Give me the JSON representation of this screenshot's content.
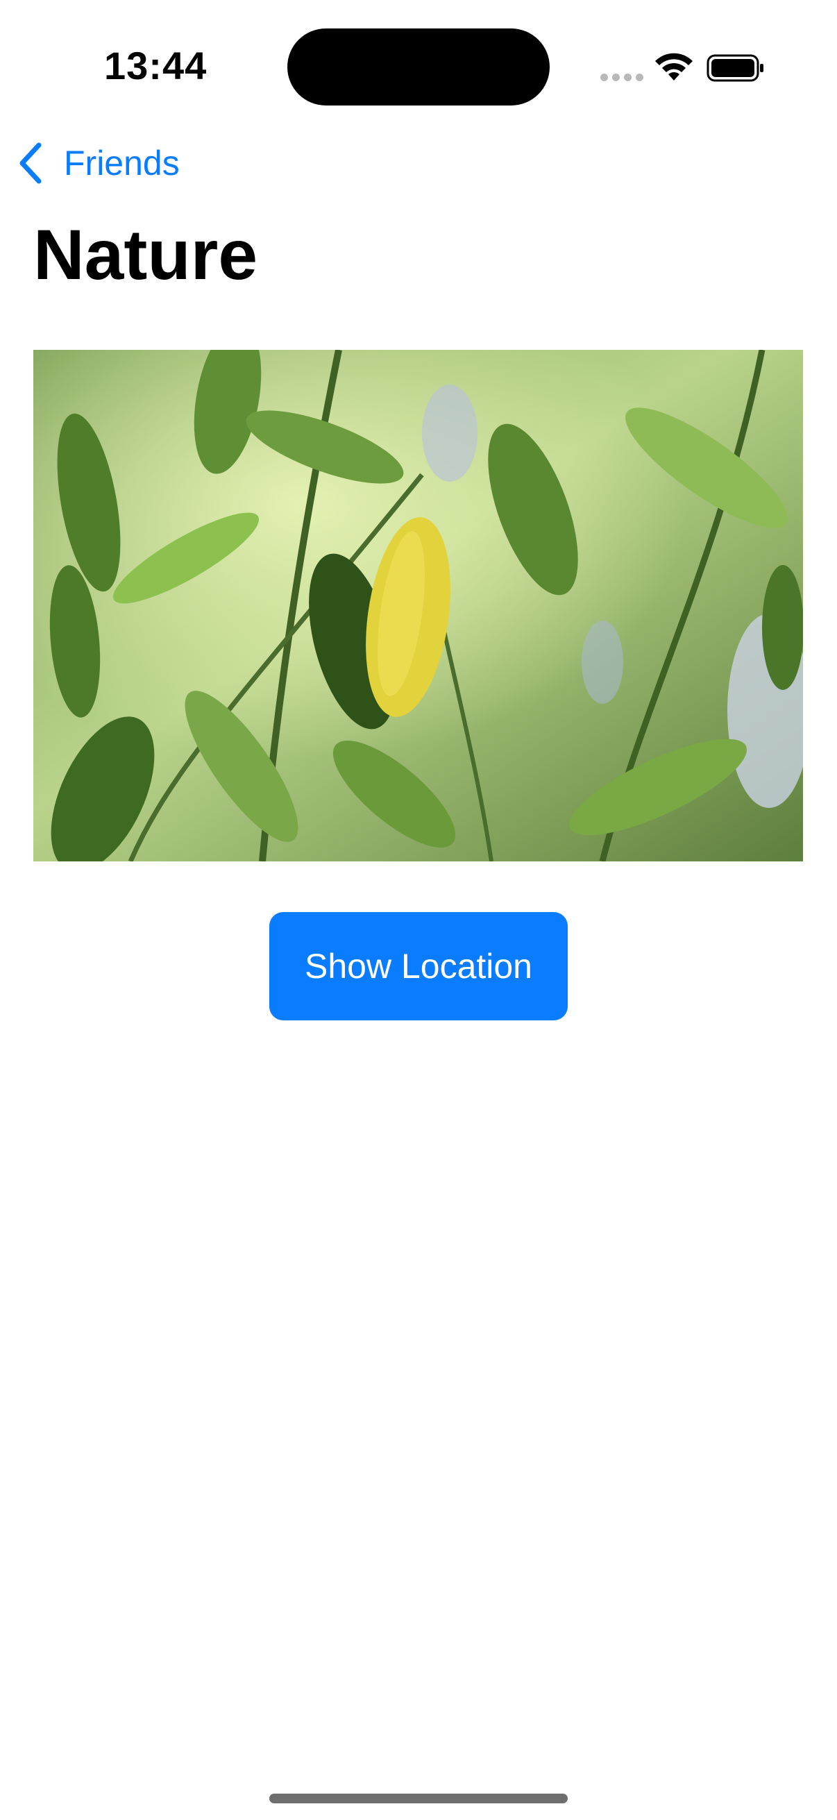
{
  "status_bar": {
    "time": "13:44",
    "wifi_icon": "wifi-icon",
    "battery_icon": "battery-icon"
  },
  "navigation": {
    "back_label": "Friends",
    "back_icon": "chevron-left-icon"
  },
  "page": {
    "title": "Nature"
  },
  "actions": {
    "show_location_label": "Show Location"
  },
  "colors": {
    "accent": "#0a7cff",
    "background": "#ffffff",
    "title": "#000000"
  }
}
